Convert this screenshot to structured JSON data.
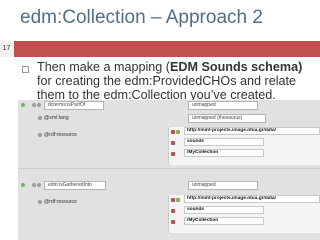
{
  "slide": {
    "title": "edm:Collection – Approach 2",
    "number": "17",
    "bullet_part1": "Then make a mapping (",
    "bullet_bold": "EDM Sounds schema)",
    "bullet_part2": " for creating the edm:ProvidedCHOs and relate them to the edm:Collection you’ve created."
  },
  "editor": {
    "group1": {
      "property": "dcterms:isPartOf",
      "status": "unmapped",
      "lang_property": "@xml:lang",
      "lang_status": "unmapped (thesaurus)",
      "resource_property": "@rdf:resource",
      "values": [
        "http://mint-projects.image.ntua.gr/data/",
        "sounds",
        "/MyCollection"
      ]
    },
    "group2": {
      "property": "edm:isGatheredInto",
      "status": "unmapped",
      "resource_property": "@rdf:resource",
      "values": [
        "http://mint-projects.image.ntua.gr/data/",
        "sounds",
        "/MyCollection"
      ]
    }
  },
  "colors": {
    "title": "#4f6f88",
    "accent_bar": "#c0504d",
    "ok_dot": "#7ab55c",
    "remove_icon": "#c0504d"
  }
}
